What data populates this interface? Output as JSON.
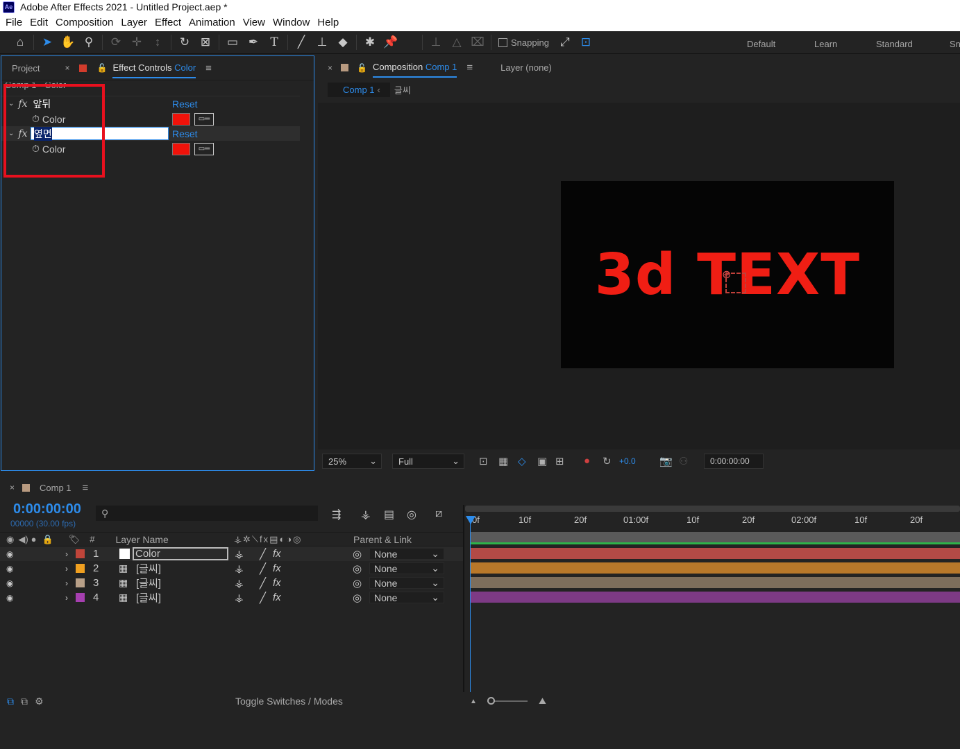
{
  "window": {
    "title": "Adobe After Effects 2021 - Untitled Project.aep *",
    "app_icon": "Ae"
  },
  "menu": [
    "File",
    "Edit",
    "Composition",
    "Layer",
    "Effect",
    "Animation",
    "View",
    "Window",
    "Help"
  ],
  "toolbar": {
    "snapping_label": "Snapping",
    "workspaces": [
      "Default",
      "Learn",
      "Standard",
      "Sn"
    ]
  },
  "effect_controls": {
    "tab_project": "Project",
    "tab_label": "Effect Controls",
    "tab_layer": "Color",
    "header": "Comp 1 • Color",
    "effects": [
      {
        "name": "앞뒤",
        "reset": "Reset",
        "param": "Color",
        "swatch": "#f0120a"
      },
      {
        "name": "옆면",
        "reset": "Reset",
        "param": "Color",
        "swatch": "#f0120a"
      }
    ]
  },
  "composition": {
    "tab_label": "Composition",
    "tab_comp": "Comp 1",
    "layer_label": "Layer (none)",
    "breadcrumb": "Comp 1",
    "breadcrumb2": "글씨",
    "stage_text": "3d TEXT",
    "zoom": "25%",
    "resolution": "Full",
    "exposure": "+0.0",
    "timecode": "0:00:00:00"
  },
  "timeline": {
    "tab": "Comp 1",
    "timecode": "0:00:00:00",
    "frames": "00000 (30.00 fps)",
    "col_layer_name": "Layer Name",
    "col_num": "#",
    "col_parent": "Parent & Link",
    "ruler": [
      "0f",
      "10f",
      "20f",
      "01:00f",
      "10f",
      "20f",
      "02:00f",
      "10f",
      "20f"
    ],
    "layers": [
      {
        "num": "1",
        "name": "Color",
        "label_color": "#c0453a",
        "parent": "None",
        "bar_color": "#b34a46"
      },
      {
        "num": "2",
        "name": "[글씨]",
        "label_color": "#f0a020",
        "parent": "None",
        "bar_color": "#b8782a"
      },
      {
        "num": "3",
        "name": "[글씨]",
        "label_color": "#b8a088",
        "parent": "None",
        "bar_color": "#7d6e5c"
      },
      {
        "num": "4",
        "name": "[글씨]",
        "label_color": "#a63fb0",
        "parent": "None",
        "bar_color": "#7d3a85"
      }
    ],
    "toggle_label": "Toggle Switches / Modes"
  },
  "colors": {
    "accent": "#2d8ceb",
    "highlight_box": "#e8101e"
  }
}
